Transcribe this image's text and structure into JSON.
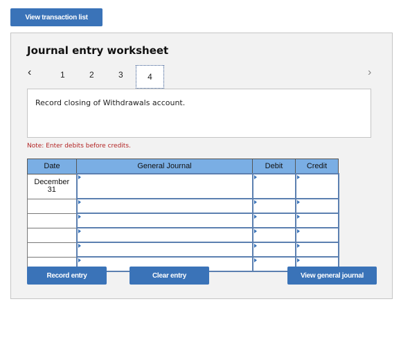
{
  "top_button": "View transaction list",
  "worksheet": {
    "title": "Journal entry worksheet",
    "tabs": [
      "1",
      "2",
      "3",
      "4"
    ],
    "active_tab": "4",
    "description": "Record closing of Withdrawals account.",
    "note": "Note: Enter debits before credits.",
    "table": {
      "headers": [
        "Date",
        "General Journal",
        "Debit",
        "Credit"
      ],
      "rows": [
        {
          "date": "December 31",
          "account": "",
          "debit": "",
          "credit": ""
        },
        {
          "date": "",
          "account": "",
          "debit": "",
          "credit": ""
        },
        {
          "date": "",
          "account": "",
          "debit": "",
          "credit": ""
        },
        {
          "date": "",
          "account": "",
          "debit": "",
          "credit": ""
        },
        {
          "date": "",
          "account": "",
          "debit": "",
          "credit": ""
        },
        {
          "date": "",
          "account": "",
          "debit": "",
          "credit": ""
        }
      ]
    },
    "buttons": {
      "record": "Record entry",
      "clear": "Clear entry",
      "view_journal": "View general journal"
    }
  },
  "icons": {
    "prev": "chevron-left-icon",
    "next": "chevron-right-icon"
  }
}
